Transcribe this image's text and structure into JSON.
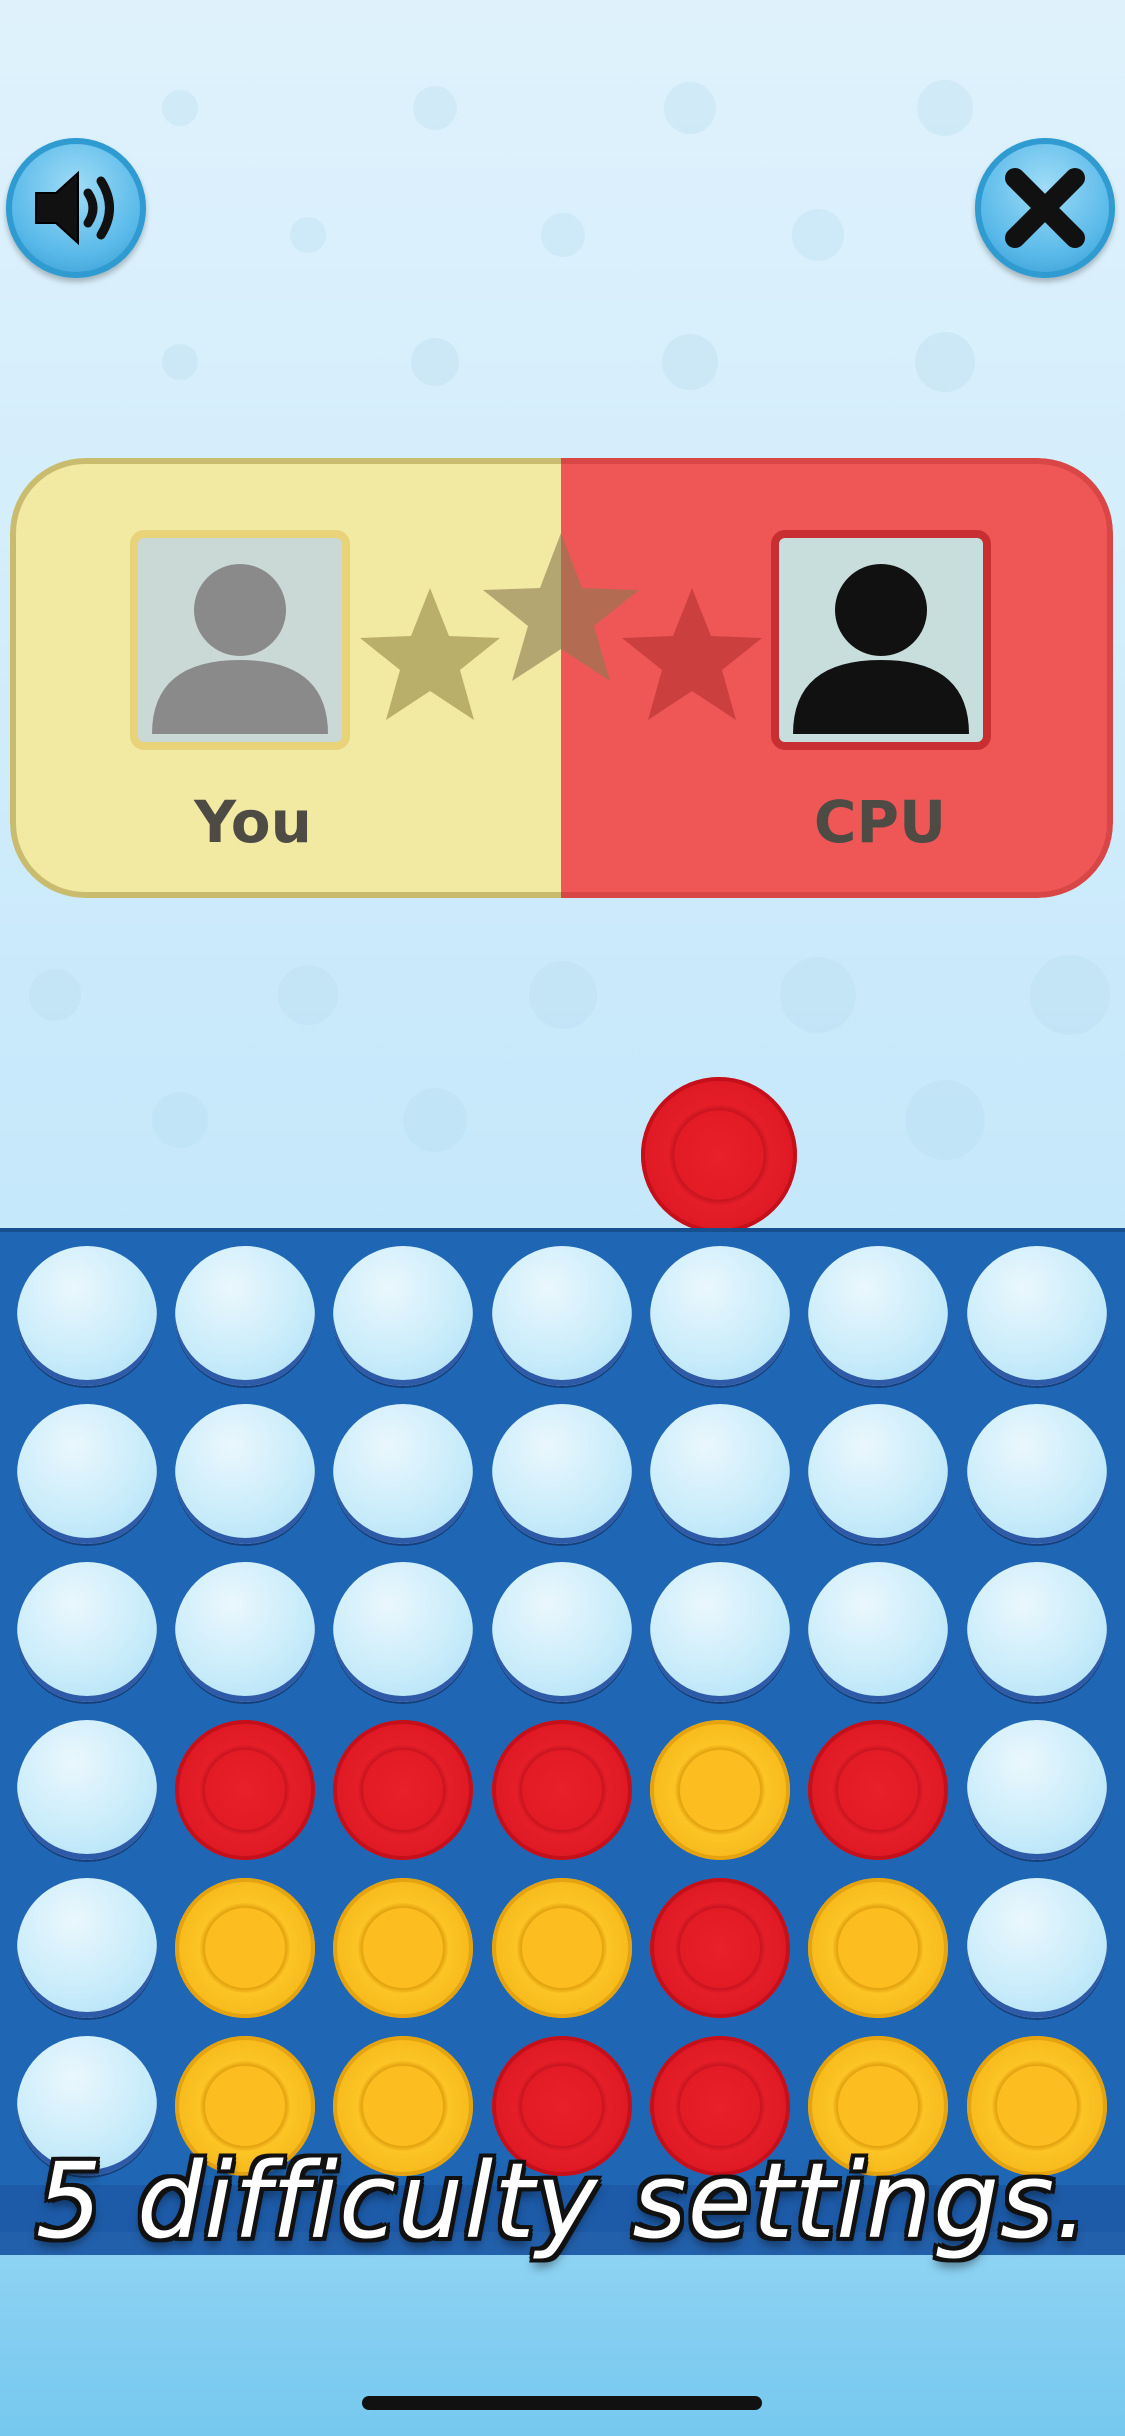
{
  "top_bar": {
    "sound_icon": "speaker-volume-icon",
    "close_icon": "close-x-icon"
  },
  "scoreboard": {
    "player_one": {
      "label": "You",
      "color": "#f2e9a3",
      "avatar_icon": "person-silhouette-icon"
    },
    "player_two": {
      "label": "CPU",
      "color": "#ef5757",
      "avatar_icon": "person-silhouette-icon"
    },
    "stars": {
      "count": 3,
      "icon": "star-icon"
    }
  },
  "game": {
    "falling_disc": {
      "color": "red",
      "column": 5
    },
    "rows": [
      [
        "empty",
        "empty",
        "empty",
        "empty",
        "empty",
        "empty",
        "empty"
      ],
      [
        "empty",
        "empty",
        "empty",
        "empty",
        "empty",
        "empty",
        "empty"
      ],
      [
        "empty",
        "empty",
        "empty",
        "empty",
        "empty",
        "empty",
        "empty"
      ],
      [
        "empty",
        "red",
        "red",
        "red",
        "yellow",
        "red",
        "empty"
      ],
      [
        "empty",
        "yellow",
        "yellow",
        "yellow",
        "red",
        "yellow",
        "empty"
      ],
      [
        "empty",
        "yellow",
        "yellow",
        "red",
        "red",
        "yellow",
        "yellow"
      ]
    ],
    "colors": {
      "red": "#e21b25",
      "yellow": "#fbbd1f",
      "board": "#1f67b5"
    }
  },
  "caption": "5 difficulty settings."
}
